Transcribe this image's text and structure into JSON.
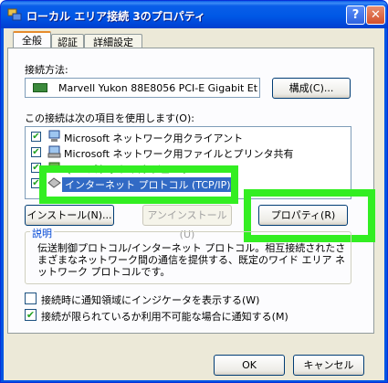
{
  "window": {
    "title": "ローカル エリア接続 3のプロパティ",
    "help_button": "?",
    "close_button": "✕"
  },
  "tabs": [
    {
      "label": "全般",
      "active": true
    },
    {
      "label": "認証",
      "active": false
    },
    {
      "label": "詳細設定",
      "active": false
    }
  ],
  "connect_using": {
    "label": "接続方法:",
    "adapter": "Marvell Yukon 88E8056 PCI-E Gigabit Et",
    "configure_button": "構成(C)..."
  },
  "components": {
    "label": "この接続は次の項目を使用します(O):",
    "items": [
      {
        "label": "Microsoft ネットワーク用クライアント",
        "checked": true,
        "selected": false
      },
      {
        "label": "Microsoft ネットワーク用ファイルとプリンタ共有",
        "checked": true,
        "selected": false
      },
      {
        "label": "QoS パケット スケジューラ",
        "checked": true,
        "selected": false
      },
      {
        "label": "インターネット プロトコル (TCP/IP)",
        "checked": true,
        "selected": true
      }
    ]
  },
  "buttons": {
    "install": "インストール(N)...",
    "uninstall": "アンインストール(U)",
    "properties": "プロパティ(R)"
  },
  "description": {
    "legend": "説明",
    "text": "伝送制御プロトコル/インターネット プロトコル。相互接続されたさまざまなネットワーク間の通信を提供する、既定のワイド エリア ネットワーク プロトコルです。"
  },
  "options": {
    "show_icon": {
      "label": "接続時に通知領域にインジケータを表示する(W)",
      "checked": false
    },
    "notify_limited": {
      "label": "接続が限られているか利用不可能な場合に通知する(M)",
      "checked": true
    }
  },
  "footer": {
    "ok": "OK",
    "cancel": "キャンセル"
  },
  "colors": {
    "highlight": "#33ee22",
    "selection": "#316ac5",
    "titlebar": "#0054e3"
  }
}
